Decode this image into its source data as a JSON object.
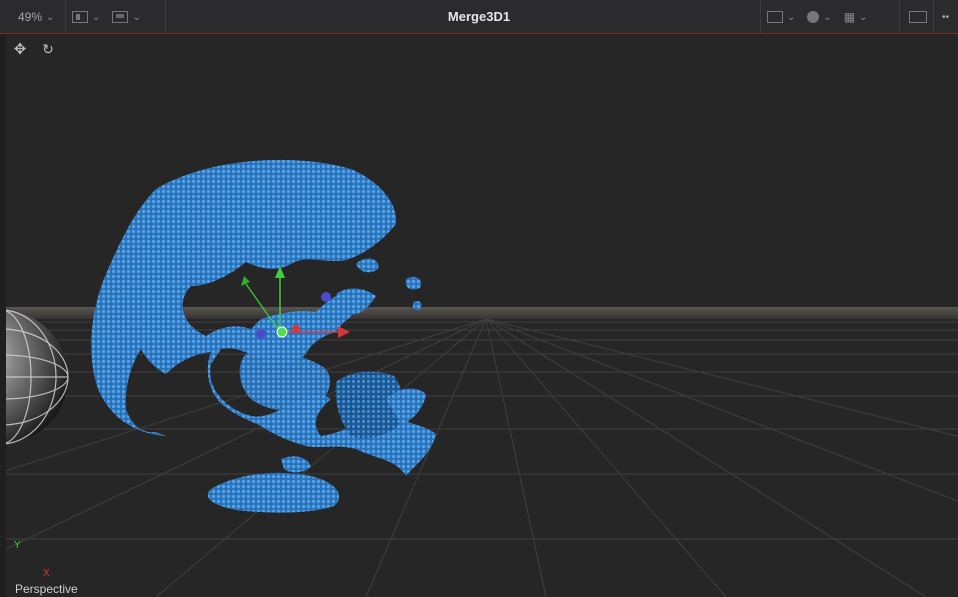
{
  "toolbar": {
    "zoom_label": "49%",
    "title": "Merge3D1",
    "overflow_label": "••"
  },
  "viewport": {
    "camera_label": "Perspective",
    "axis_y_label": "Y",
    "axis_x_label": "X"
  },
  "colors": {
    "accent_line": "#7a2a2a",
    "globe_blue": "#2e7fcf",
    "gizmo_green": "#3ecf3e",
    "gizmo_red": "#d23a3a"
  }
}
